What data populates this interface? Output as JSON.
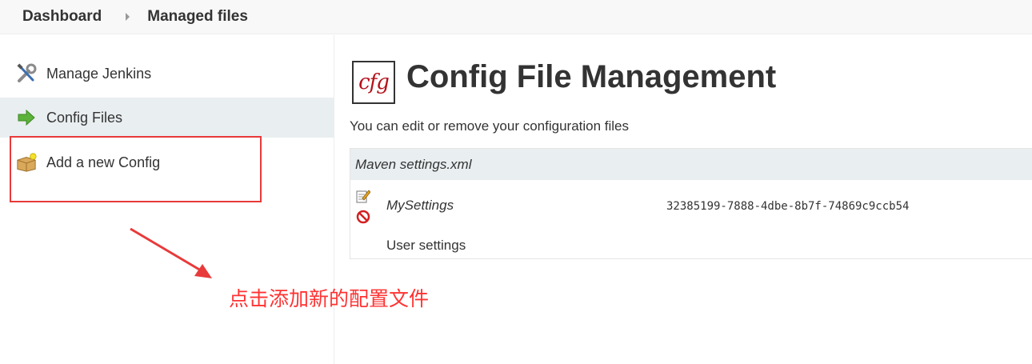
{
  "breadcrumb": {
    "items": [
      "Dashboard",
      "Managed files"
    ]
  },
  "sidebar": {
    "items": [
      {
        "label": "Manage Jenkins",
        "icon": "wrench-screwdriver-icon"
      },
      {
        "label": "Config Files",
        "icon": "green-arrow-icon",
        "active": true
      },
      {
        "label": "Add a new Config",
        "icon": "box-new-icon"
      }
    ]
  },
  "annotation": {
    "text": "点击添加新的配置文件",
    "color": "#ff3333"
  },
  "main": {
    "logo_text": "cfg",
    "title": "Config File Management",
    "description": "You can edit or remove your configuration files",
    "table": {
      "group_header": "Maven settings.xml",
      "rows": [
        {
          "name": "MySettings",
          "id": "32385199-7888-4dbe-8b7f-74869c9ccb54",
          "comment": "User settings"
        }
      ]
    }
  },
  "colors": {
    "active_row": "#e9eef0",
    "highlight": "#e83a3a",
    "logo_red": "#b5121b"
  }
}
